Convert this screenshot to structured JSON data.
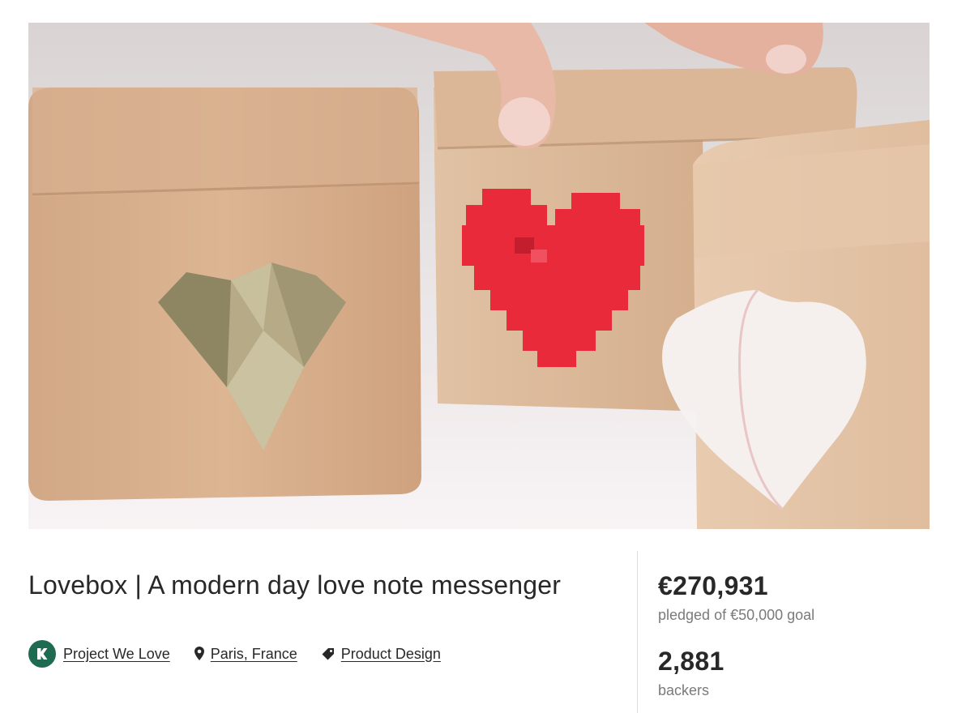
{
  "hero": {
    "image_alt": "Wooden Lovebox cubes with hearts"
  },
  "project": {
    "title": "Lovebox | A modern day love note messenger",
    "badge_label": "Project We Love",
    "location": "Paris, France",
    "category": "Product Design"
  },
  "stats": {
    "pledged_amount": "€270,931",
    "pledged_label": "pledged of €50,000 goal",
    "backers_count": "2,881",
    "backers_label": "backers"
  },
  "colors": {
    "brand_green": "#1f6b52",
    "text_primary": "#282828",
    "text_secondary": "#7a7a7a"
  }
}
